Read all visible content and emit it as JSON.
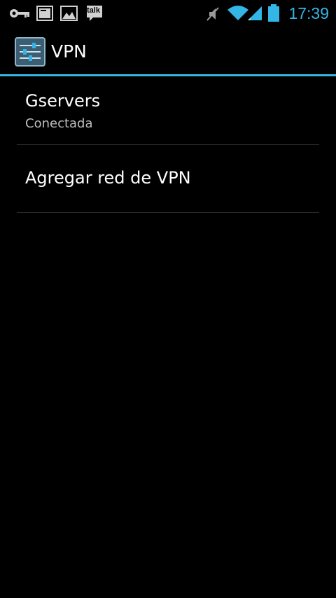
{
  "status_bar": {
    "time": "17:39",
    "accent_color": "#33b5e5",
    "notification_icons": [
      "vpn-key-icon",
      "screenshot-icon",
      "image-icon",
      "talk-icon"
    ],
    "talk_label": "talk",
    "system_icons": [
      "mute-icon",
      "wifi-icon",
      "signal-icon",
      "battery-icon"
    ]
  },
  "action_bar": {
    "title": "VPN",
    "app_icon": "settings-sliders-icon"
  },
  "vpn_list": {
    "items": [
      {
        "name": "Gservers",
        "status": "Conectada"
      }
    ],
    "add_label": "Agregar red de VPN"
  }
}
